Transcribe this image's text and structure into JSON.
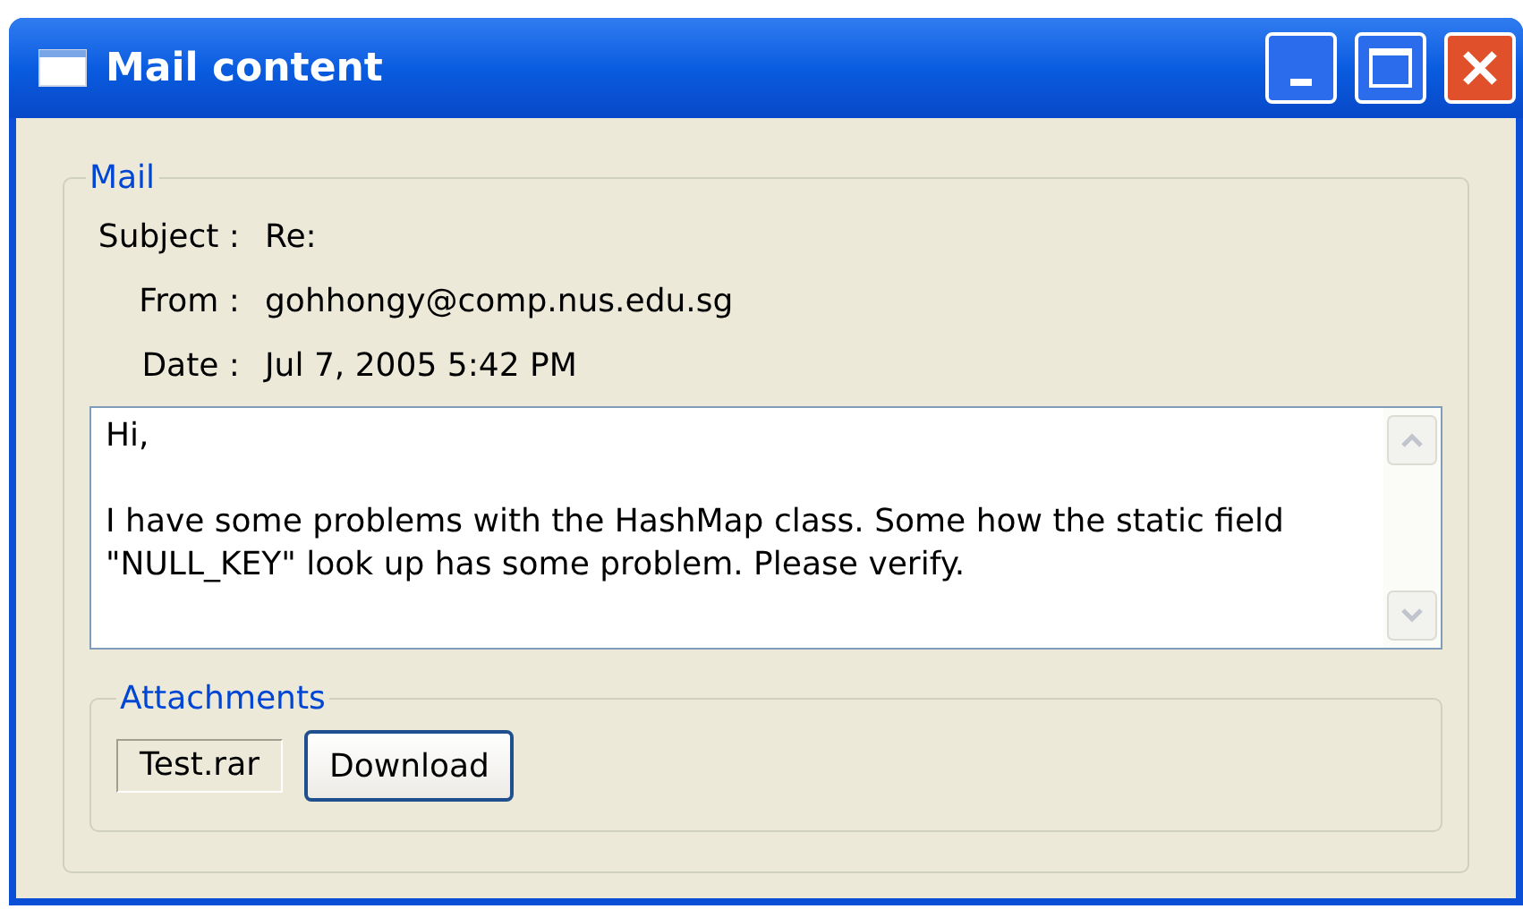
{
  "window": {
    "title": "Mail content"
  },
  "mail": {
    "legend": "Mail",
    "fields": [
      {
        "label": "Subject :",
        "value": "Re:"
      },
      {
        "label": "From :",
        "value": "gohhongy@comp.nus.edu.sg"
      },
      {
        "label": "Date :",
        "value": "Jul 7, 2005 5:42 PM"
      }
    ],
    "body": [
      "Hi,",
      "I have some problems with the HashMap class. Some how the static field \"NULL_KEY\" look up has some problem. Please verify."
    ]
  },
  "attachments": {
    "legend": "Attachments",
    "file": "Test.rar",
    "button": "Download"
  }
}
